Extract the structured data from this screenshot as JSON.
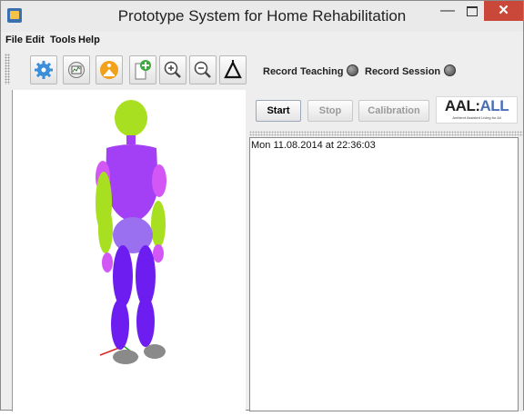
{
  "window": {
    "title": "Prototype System for Home Rehabilitation"
  },
  "menu": [
    "File",
    "Edit",
    "Tools",
    "Help"
  ],
  "toolbar": {
    "icons": [
      "settings-gear",
      "chart-monitor",
      "exercise-figure",
      "add-document",
      "zoom-in",
      "zoom-out",
      "triangle-axes"
    ],
    "record_teaching": "Record Teaching",
    "record_session": "Record Session"
  },
  "controls": {
    "start": "Start",
    "stop": "Stop",
    "calibration": "Calibration"
  },
  "logo": {
    "main_aal": "AAL",
    "main_all": "ALL",
    "subtitle": "Ambient Assisted Living for All"
  },
  "log": [
    "Mon 11.08.2014 at 22:36:03"
  ],
  "colors": {
    "head": "#a8e021",
    "torso": "#a33ff5",
    "pelvis": "#9b70f0",
    "legs": "#6d1df0",
    "feet": "#8a8a8a"
  }
}
